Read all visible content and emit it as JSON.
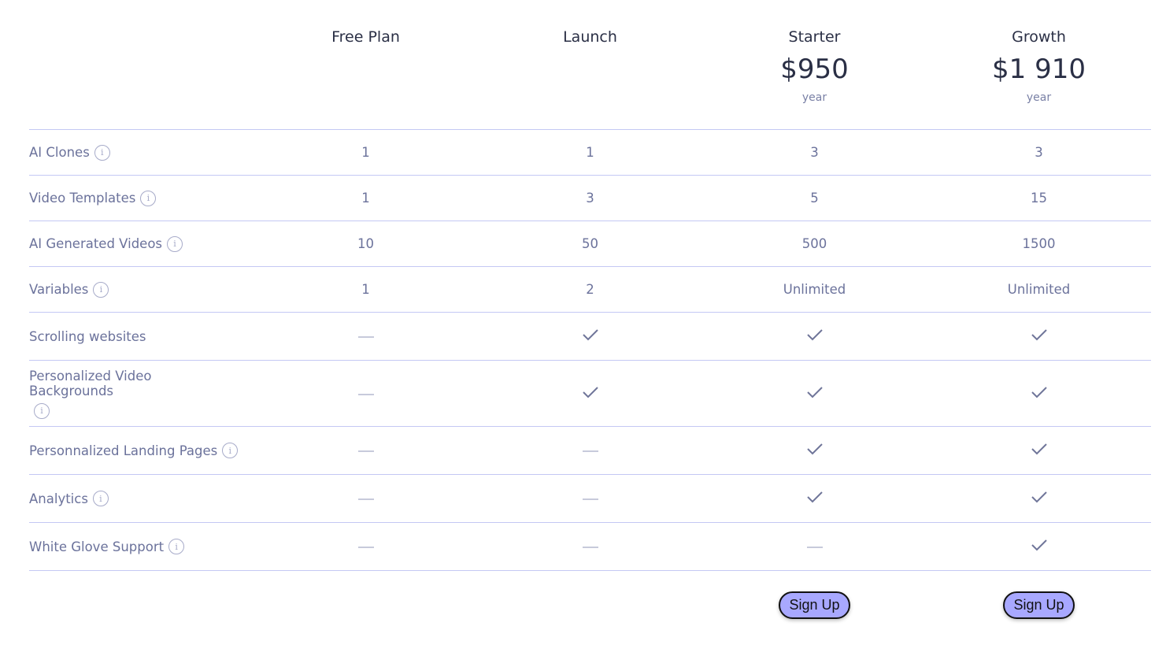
{
  "plans": [
    {
      "name": "Free Plan",
      "price": "",
      "period": "",
      "cta": ""
    },
    {
      "name": "Launch",
      "price": "",
      "period": "",
      "cta": ""
    },
    {
      "name": "Starter",
      "price": "$950",
      "period": "year",
      "cta": "Sign Up"
    },
    {
      "name": "Growth",
      "price": "$1 910",
      "period": "year",
      "cta": "Sign Up"
    }
  ],
  "features": [
    {
      "label": "AI Clones",
      "info": true,
      "values": [
        "1",
        "1",
        "3",
        "3"
      ]
    },
    {
      "label": "Video Templates",
      "info": true,
      "values": [
        "1",
        "3",
        "5",
        "15"
      ]
    },
    {
      "label": "AI Generated Videos",
      "info": true,
      "values": [
        "10",
        "50",
        "500",
        "1500"
      ]
    },
    {
      "label": "Variables",
      "info": true,
      "values": [
        "1",
        "2",
        "Unlimited",
        "Unlimited"
      ]
    },
    {
      "label": "Scrolling websites",
      "info": false,
      "values": [
        "dash",
        "check",
        "check",
        "check"
      ]
    },
    {
      "label": "Personalized Video Backgrounds",
      "info": true,
      "values": [
        "dash",
        "check",
        "check",
        "check"
      ]
    },
    {
      "label": "Personnalized Landing Pages",
      "info": true,
      "values": [
        "dash",
        "dash",
        "check",
        "check"
      ]
    },
    {
      "label": "Analytics",
      "info": true,
      "values": [
        "dash",
        "dash",
        "check",
        "check"
      ]
    },
    {
      "label": "White Glove Support",
      "info": true,
      "values": [
        "dash",
        "dash",
        "dash",
        "check"
      ]
    }
  ],
  "icons": {
    "info": "info-circle-icon",
    "check": "checkmark-icon",
    "dash": "dash-icon",
    "info_glyph": "i"
  },
  "colors": {
    "accent": "#a8a8ff",
    "divider": "#c4c8f4",
    "text": "#6b729b",
    "heading": "#2a2f45"
  }
}
